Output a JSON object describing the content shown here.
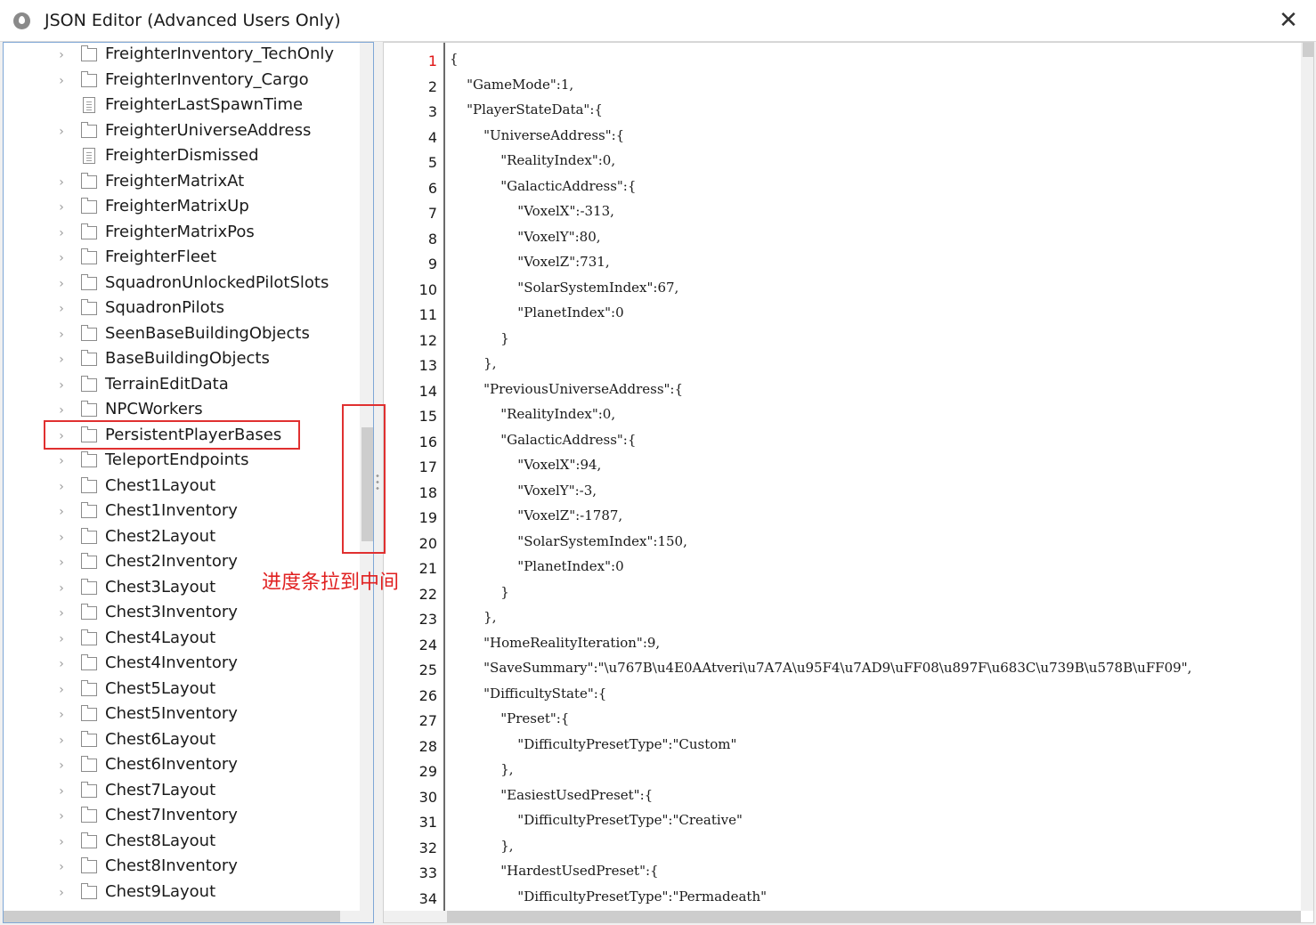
{
  "window": {
    "title": "JSON Editor (Advanced Users Only)",
    "close_glyph": "✕",
    "app_icon": "app-logo-icon"
  },
  "tree": {
    "items": [
      {
        "label": "FreighterInventory_TechOnly",
        "type": "folder",
        "expandable": true
      },
      {
        "label": "FreighterInventory_Cargo",
        "type": "folder",
        "expandable": true
      },
      {
        "label": "FreighterLastSpawnTime",
        "type": "file",
        "expandable": false
      },
      {
        "label": "FreighterUniverseAddress",
        "type": "folder",
        "expandable": true
      },
      {
        "label": "FreighterDismissed",
        "type": "file",
        "expandable": false
      },
      {
        "label": "FreighterMatrixAt",
        "type": "folder",
        "expandable": true
      },
      {
        "label": "FreighterMatrixUp",
        "type": "folder",
        "expandable": true
      },
      {
        "label": "FreighterMatrixPos",
        "type": "folder",
        "expandable": true
      },
      {
        "label": "FreighterFleet",
        "type": "folder",
        "expandable": true
      },
      {
        "label": "SquadronUnlockedPilotSlots",
        "type": "folder",
        "expandable": true
      },
      {
        "label": "SquadronPilots",
        "type": "folder",
        "expandable": true
      },
      {
        "label": "SeenBaseBuildingObjects",
        "type": "folder",
        "expandable": true
      },
      {
        "label": "BaseBuildingObjects",
        "type": "folder",
        "expandable": true
      },
      {
        "label": "TerrainEditData",
        "type": "folder",
        "expandable": true
      },
      {
        "label": "NPCWorkers",
        "type": "folder",
        "expandable": true
      },
      {
        "label": "PersistentPlayerBases",
        "type": "folder",
        "expandable": true
      },
      {
        "label": "TeleportEndpoints",
        "type": "folder",
        "expandable": true
      },
      {
        "label": "Chest1Layout",
        "type": "folder",
        "expandable": true
      },
      {
        "label": "Chest1Inventory",
        "type": "folder",
        "expandable": true
      },
      {
        "label": "Chest2Layout",
        "type": "folder",
        "expandable": true
      },
      {
        "label": "Chest2Inventory",
        "type": "folder",
        "expandable": true
      },
      {
        "label": "Chest3Layout",
        "type": "folder",
        "expandable": true
      },
      {
        "label": "Chest3Inventory",
        "type": "folder",
        "expandable": true
      },
      {
        "label": "Chest4Layout",
        "type": "folder",
        "expandable": true
      },
      {
        "label": "Chest4Inventory",
        "type": "folder",
        "expandable": true
      },
      {
        "label": "Chest5Layout",
        "type": "folder",
        "expandable": true
      },
      {
        "label": "Chest5Inventory",
        "type": "folder",
        "expandable": true
      },
      {
        "label": "Chest6Layout",
        "type": "folder",
        "expandable": true
      },
      {
        "label": "Chest6Inventory",
        "type": "folder",
        "expandable": true
      },
      {
        "label": "Chest7Layout",
        "type": "folder",
        "expandable": true
      },
      {
        "label": "Chest7Inventory",
        "type": "folder",
        "expandable": true
      },
      {
        "label": "Chest8Layout",
        "type": "folder",
        "expandable": true
      },
      {
        "label": "Chest8Inventory",
        "type": "folder",
        "expandable": true
      },
      {
        "label": "Chest9Layout",
        "type": "folder",
        "expandable": true
      }
    ],
    "chevron_glyph": "›",
    "highlighted_item": "PersistentPlayerBases"
  },
  "editor": {
    "current_line": 1,
    "lines": [
      "{",
      "    \"GameMode\":1,",
      "    \"PlayerStateData\":{",
      "        \"UniverseAddress\":{",
      "            \"RealityIndex\":0,",
      "            \"GalacticAddress\":{",
      "                \"VoxelX\":-313,",
      "                \"VoxelY\":80,",
      "                \"VoxelZ\":731,",
      "                \"SolarSystemIndex\":67,",
      "                \"PlanetIndex\":0",
      "            }",
      "        },",
      "        \"PreviousUniverseAddress\":{",
      "            \"RealityIndex\":0,",
      "            \"GalacticAddress\":{",
      "                \"VoxelX\":94,",
      "                \"VoxelY\":-3,",
      "                \"VoxelZ\":-1787,",
      "                \"SolarSystemIndex\":150,",
      "                \"PlanetIndex\":0",
      "            }",
      "        },",
      "        \"HomeRealityIteration\":9,",
      "        \"SaveSummary\":\"\\u767B\\u4E0AAtveri\\u7A7A\\u95F4\\u7AD9\\uFF08\\u897F\\u683C\\u739B\\u578B\\uFF09\",",
      "        \"DifficultyState\":{",
      "            \"Preset\":{",
      "                \"DifficultyPresetType\":\"Custom\"",
      "            },",
      "            \"EasiestUsedPreset\":{",
      "                \"DifficultyPresetType\":\"Creative\"",
      "            },",
      "            \"HardestUsedPreset\":{",
      "                \"DifficultyPresetType\":\"Permadeath\""
    ]
  },
  "annotation": {
    "text": "进度条拉到中间",
    "color": "#e03030"
  }
}
